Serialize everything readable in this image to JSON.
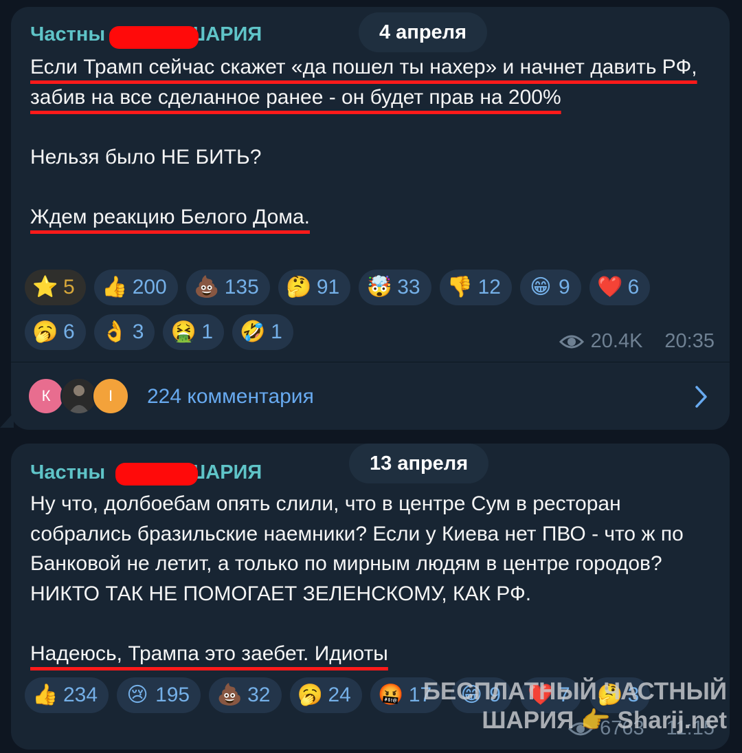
{
  "post1": {
    "author_prefix": "Частны",
    "author_suffix": "ШАРИЯ",
    "date": "4 апреля",
    "paragraphs": {
      "p1": "Если Трамп сейчас скажет «да пошел ты нахер» и начнет давить РФ, забив на все сделанное ранее - он будет прав на 200%",
      "p2": "Нельзя было НЕ БИТЬ?",
      "p3": "Ждем реакцию Белого Дома."
    },
    "reactions": [
      {
        "icon": "star-icon",
        "glyph": "⭐",
        "count": "5"
      },
      {
        "icon": "thumbs-up-icon",
        "glyph": "👍",
        "count": "200"
      },
      {
        "icon": "poop-icon",
        "glyph": "💩",
        "count": "135"
      },
      {
        "icon": "thinking-face-icon",
        "glyph": "🤔",
        "count": "91"
      },
      {
        "icon": "exploding-head-icon",
        "glyph": "🤯",
        "count": "33"
      },
      {
        "icon": "thumbs-down-icon",
        "glyph": "👎",
        "count": "12"
      },
      {
        "icon": "grinning-face-icon",
        "glyph": "😁",
        "count": "9"
      },
      {
        "icon": "red-heart-icon",
        "glyph": "❤️",
        "count": "6"
      },
      {
        "icon": "yawning-face-icon",
        "glyph": "🥱",
        "count": "6"
      },
      {
        "icon": "ok-hand-icon",
        "glyph": "👌",
        "count": "3"
      },
      {
        "icon": "vomiting-face-icon",
        "glyph": "🤮",
        "count": "1"
      },
      {
        "icon": "rofl-face-icon",
        "glyph": "🤣",
        "count": "1"
      }
    ],
    "views": "20.4K",
    "time": "20:35",
    "comments": {
      "label": "224 комментария",
      "avatar_letters": [
        "К",
        "I"
      ]
    }
  },
  "post2": {
    "author_prefix": "Частны",
    "author_suffix": "ШАРИЯ",
    "date": "13 апреля",
    "paragraphs": {
      "p1": "Ну что, долбоебам опять слили, что в центре Сум в ресторан собрались бразильские наемники? Если у Киева нет ПВО - что ж по Банковой не летит, а только по мирным людям в центре городов? НИКТО ТАК НЕ ПОМОГАЕТ ЗЕЛЕНСКОМУ, КАК РФ.",
      "p2": "Надеюсь, Трампа это заебет. Идиоты"
    },
    "reactions": [
      {
        "icon": "thumbs-up-icon",
        "glyph": "👍",
        "count": "234"
      },
      {
        "icon": "crying-face-icon",
        "glyph": "😢",
        "count": "195"
      },
      {
        "icon": "poop-icon",
        "glyph": "💩",
        "count": "32"
      },
      {
        "icon": "yawning-face-icon",
        "glyph": "🥱",
        "count": "24"
      },
      {
        "icon": "cursing-face-icon",
        "glyph": "🤬",
        "count": "17"
      },
      {
        "icon": "grinning-face-icon",
        "glyph": "😁",
        "count": "9"
      },
      {
        "icon": "red-heart-icon",
        "glyph": "❤️",
        "count": "7"
      },
      {
        "icon": "thinking-face-icon",
        "glyph": "🤔",
        "count": "3"
      }
    ],
    "views": "6763",
    "time": "11:15"
  },
  "watermark": {
    "line1": "БЕСПЛАТНЫЙ ЧАСТНЫЙ",
    "line2_left": "ШАРИЯ",
    "line2_right": "Sharij.net"
  },
  "colors": {
    "background": "#0e1621",
    "bubble": "#182533",
    "author": "#5fc4c8",
    "link": "#68aaf0",
    "underline": "#ff1a1a"
  }
}
